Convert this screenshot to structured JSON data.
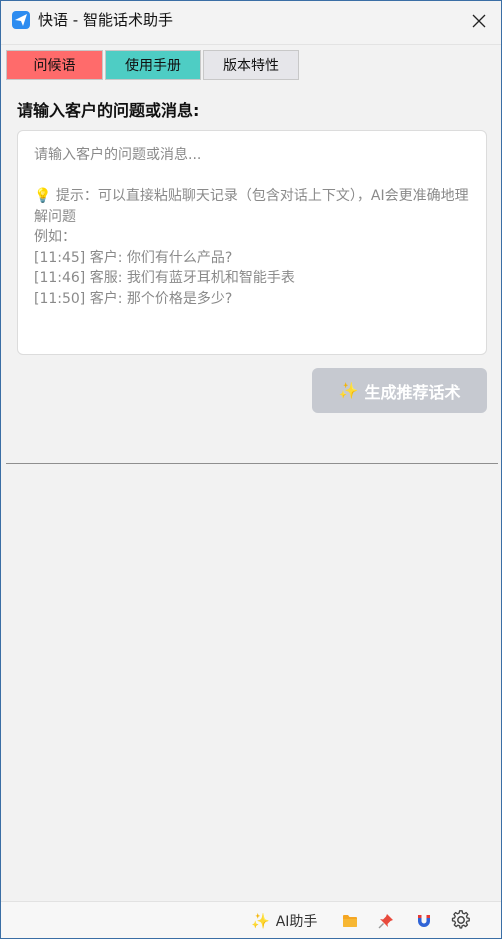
{
  "window": {
    "title": "快语 - 智能话术助手"
  },
  "tabs": [
    {
      "label": "问候语",
      "color": "#ff6b6b"
    },
    {
      "label": "使用手册",
      "color": "#4ecdc4"
    },
    {
      "label": "版本特性",
      "color": "#e6e6ea"
    }
  ],
  "main": {
    "prompt_label": "请输入客户的问题或消息:",
    "input": {
      "value": "",
      "placeholder": "请输入客户的问题或消息...\n\n💡 提示：可以直接粘贴聊天记录（包含对话上下文），AI会更准确地理解问题\n例如：\n[11:45] 客户: 你们有什么产品?\n[11:46] 客服: 我们有蓝牙耳机和智能手表\n[11:50] 客户: 那个价格是多少?"
    },
    "generate_button": {
      "icon": "✨",
      "label": "生成推荐话术"
    }
  },
  "statusbar": {
    "ai_assistant": {
      "icon": "✨",
      "label": "AI助手"
    },
    "icons": [
      "folder-icon",
      "pin-icon",
      "magnet-icon",
      "gear-icon"
    ]
  },
  "colors": {
    "accent_blue": "#2d8cf0",
    "button_disabled": "#c6c9d0"
  }
}
